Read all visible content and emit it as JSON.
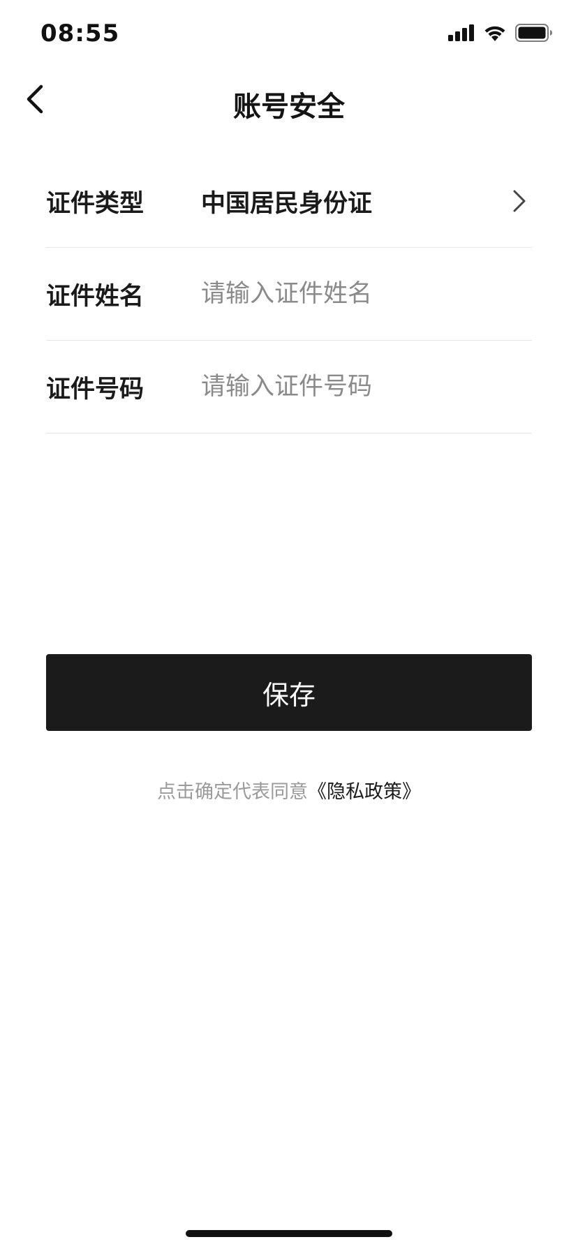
{
  "status_bar": {
    "time": "08:55",
    "icons": [
      "signal-icon",
      "wifi-icon",
      "battery-icon"
    ]
  },
  "nav": {
    "title": "账号安全",
    "back_icon": "chevron-left-icon"
  },
  "form": {
    "id_type": {
      "label": "证件类型",
      "value": "中国居民身份证",
      "icon": "chevron-right-icon"
    },
    "id_name": {
      "label": "证件姓名",
      "value": "",
      "placeholder": "请输入证件姓名"
    },
    "id_number": {
      "label": "证件号码",
      "value": "",
      "placeholder": "请输入证件号码"
    }
  },
  "actions": {
    "save_label": "保存"
  },
  "policy": {
    "prefix": "点击确定代表同意",
    "link": "《隐私政策》"
  },
  "colors": {
    "primary_button": "#1b1b1b",
    "placeholder": "#8a8a8a",
    "divider": "#e6e6e6",
    "hint_text": "#9a9a9a"
  }
}
